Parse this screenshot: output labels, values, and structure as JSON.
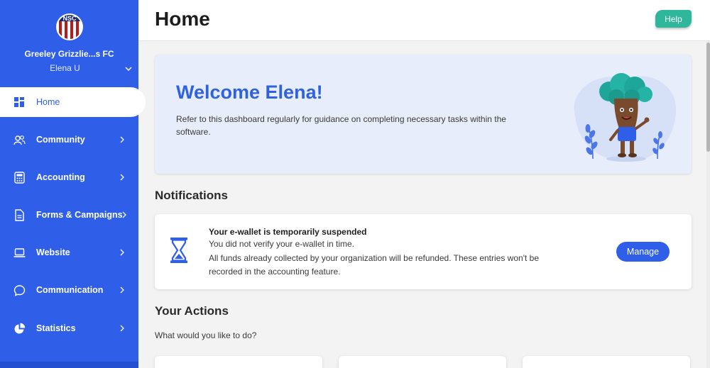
{
  "sidebar": {
    "org_name": "Greeley Grizzlie...s FC",
    "user_name": "Elena U",
    "logo_icon": "club-crest",
    "items": [
      {
        "label": "Home",
        "icon": "dashboard-icon",
        "active": true
      },
      {
        "label": "Community",
        "icon": "users-icon"
      },
      {
        "label": "Accounting",
        "icon": "calculator-icon"
      },
      {
        "label": "Forms & Campaigns",
        "icon": "document-icon"
      },
      {
        "label": "Website",
        "icon": "laptop-icon"
      },
      {
        "label": "Communication",
        "icon": "chat-icon"
      },
      {
        "label": "Statistics",
        "icon": "pie-chart-icon"
      }
    ]
  },
  "header": {
    "title": "Home",
    "help_label": "Help"
  },
  "welcome": {
    "title": "Welcome Elena!",
    "text": "Refer to this dashboard regularly for guidance on completing necessary tasks within the software."
  },
  "notifications": {
    "title": "Notifications",
    "items": [
      {
        "heading": "Your e-wallet is temporarily suspended",
        "line1": "You did not verify your e-wallet in time.",
        "line2": "All funds already collected by your organization will be refunded. These entries won't be recorded in the accounting feature.",
        "action_label": "Manage",
        "icon": "hourglass-icon"
      }
    ]
  },
  "actions": {
    "title": "Your Actions",
    "subtitle": "What would you like to do?"
  },
  "colors": {
    "primary": "#2f5fe8",
    "help": "#2fb79c",
    "welcome_bg": "#e7edfb"
  }
}
